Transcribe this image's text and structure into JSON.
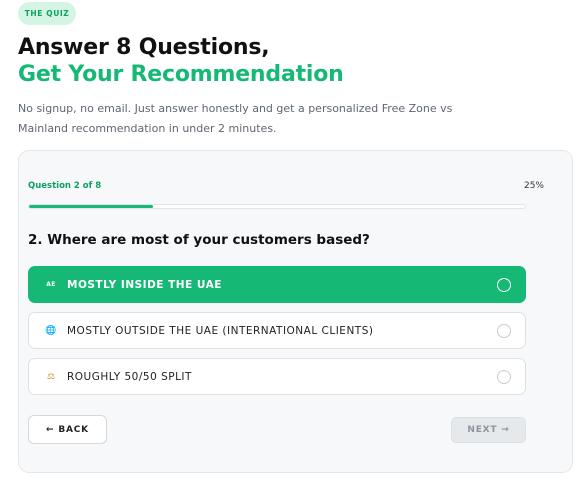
{
  "header": {
    "badge": "THE QUIZ",
    "title_line1": "Answer 8 Questions,",
    "title_line2": "Get Your Recommendation",
    "description": "No signup, no email. Just answer honestly and get a personalized Free Zone vs Mainland recommendation in under 2 minutes."
  },
  "quiz": {
    "progress_label": "Question 2 of 8",
    "progress_percent_label": "25%",
    "progress_value": 0.25,
    "question": "2. Where are most of your customers based?",
    "options": [
      {
        "icon": "flag-ae-icon",
        "emoji": "AE",
        "label": "MOSTLY INSIDE THE UAE",
        "selected": true
      },
      {
        "icon": "globe-icon",
        "emoji": "🌐",
        "label": "MOSTLY OUTSIDE THE UAE (INTERNATIONAL CLIENTS)",
        "selected": false
      },
      {
        "icon": "balance-scale-icon",
        "emoji": "⚖",
        "label": "ROUGHLY 50/50 SPLIT",
        "selected": false
      }
    ],
    "back_label": "← BACK",
    "next_label": "NEXT →"
  },
  "colors": {
    "accent": "#16b876",
    "accent_dark": "#0f9f63",
    "badge_bg": "#d4f5e4",
    "card_bg": "#f7f8f9",
    "muted_text": "#5f6671"
  }
}
